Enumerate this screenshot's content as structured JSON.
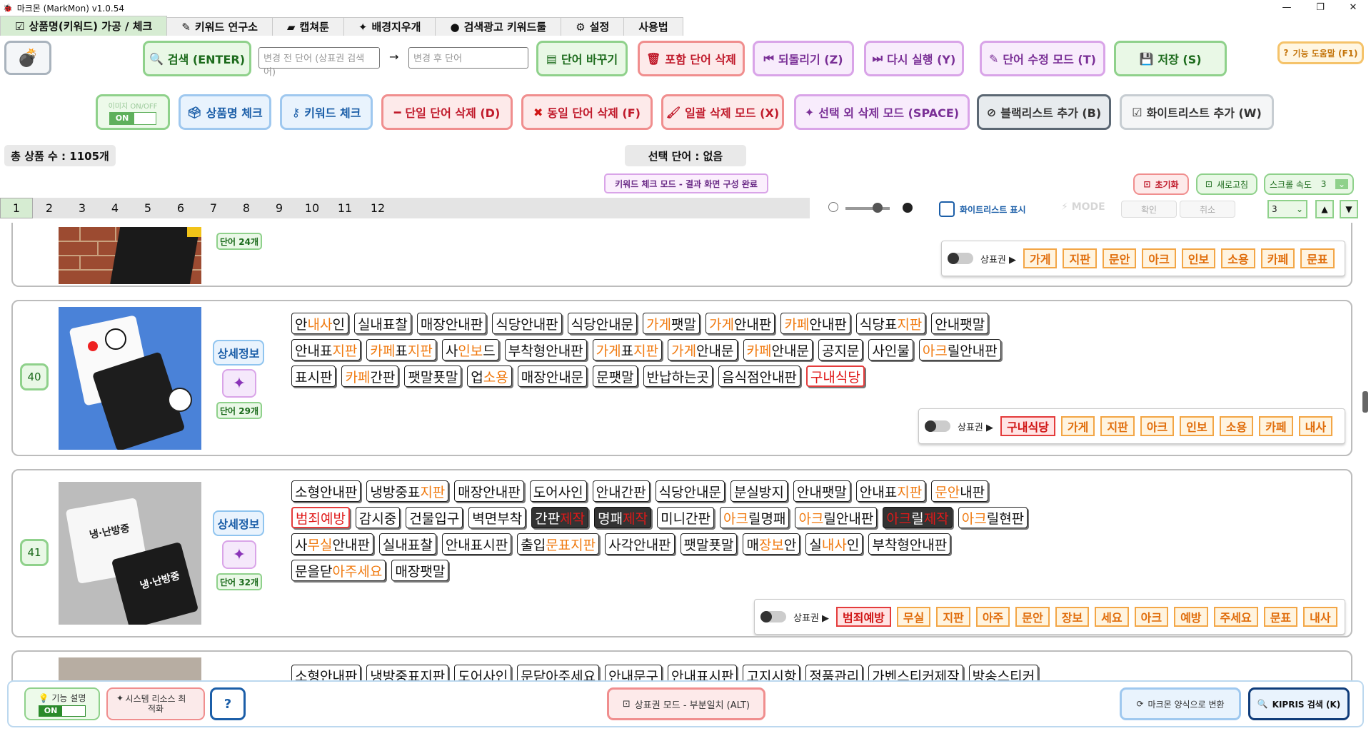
{
  "window": {
    "title": "마크몬 (MarkMon) v1.0.54"
  },
  "tabs": [
    {
      "icon": "check-box-icon",
      "label": "상품명(키워드) 가공 / 체크"
    },
    {
      "icon": "pencil-icon",
      "label": "키워드 연구소"
    },
    {
      "icon": "camera-icon",
      "label": "캡쳐툰"
    },
    {
      "icon": "sparkle-icon",
      "label": "배경지우개"
    },
    {
      "icon": "cookie-icon",
      "label": "검색광고 키워드툴"
    },
    {
      "icon": "gear-icon",
      "label": "설정"
    },
    {
      "icon": "",
      "label": "사용법"
    }
  ],
  "toolbar": {
    "search": "검색 (ENTER)",
    "before_placeholder": "변경 전 단어 (상표권 검색어)",
    "arrow": "→",
    "after_placeholder": "변경 후 단어",
    "replace": "단어 바꾸기",
    "include_delete": "포함 단어 삭제",
    "undo": "되돌리기 (Z)",
    "redo": "다시 실행 (Y)",
    "edit_mode": "단어 수정 모드 (T)",
    "save": "저장 (S)",
    "help": "기능 도움말 (F1)",
    "image_toggle_label": "이미지 ON/OFF",
    "image_toggle_state": "ON",
    "product_check": "상품명 체크",
    "keyword_check": "키워드 체크",
    "single_delete": "단일 단어 삭제 (D)",
    "same_delete": "동일 단어 삭제 (F)",
    "bulk_delete": "일괄 삭제 모드 (X)",
    "except_delete": "선택 외 삭제 모드 (SPACE)",
    "blacklist": "블랙리스트 추가 (B)",
    "whitelist": "화이트리스트 추가 (W)"
  },
  "status": {
    "total": "총 상품 수 : 1105개",
    "selected": "선택 단어 : 없음",
    "mode": "키워드 체크 모드 - 결과 화면 구성 완료"
  },
  "controls": {
    "reset": "초기화",
    "refresh": "새로고침",
    "scroll_speed_label": "스크롤 속도",
    "scroll_speed_value": "3",
    "whitelist_show": "화이트리스트 표시",
    "mode": "MODE",
    "confirm": "확인",
    "cancel": "취소",
    "page_select": "3"
  },
  "pages": [
    "1",
    "2",
    "3",
    "4",
    "5",
    "6",
    "7",
    "8",
    "9",
    "10",
    "11",
    "12"
  ],
  "cards": [
    {
      "number": "",
      "word_count": "단어 24개",
      "trademark_label": "상표권 ▶",
      "trademarks": [
        {
          "t": "가게"
        },
        {
          "t": "지판"
        },
        {
          "t": "문안"
        },
        {
          "t": "아크"
        },
        {
          "t": "인보"
        },
        {
          "t": "소용"
        },
        {
          "t": "카페"
        },
        {
          "t": "문표"
        }
      ]
    },
    {
      "number": "40",
      "detail": "상세정보",
      "word_count": "단어 29개",
      "trademark_label": "상표권 ▶",
      "trademarks": [
        {
          "t": "구내식당",
          "red": true
        },
        {
          "t": "가게"
        },
        {
          "t": "지판"
        },
        {
          "t": "아크"
        },
        {
          "t": "인보"
        },
        {
          "t": "소용"
        },
        {
          "t": "카페"
        },
        {
          "t": "내사"
        }
      ],
      "chips": [
        [
          [
            "안",
            ""
          ],
          [
            "내사",
            "o"
          ],
          [
            "인",
            ""
          ]
        ],
        [
          [
            "실내표찰",
            ""
          ]
        ],
        [
          [
            "매장안내판",
            ""
          ]
        ],
        [
          [
            "식당안내판",
            ""
          ]
        ],
        [
          [
            "식당안내문",
            ""
          ]
        ],
        [
          [
            "가게",
            "o"
          ],
          [
            "팻말",
            ""
          ]
        ],
        [
          [
            "가게",
            "o"
          ],
          [
            "안내판",
            ""
          ]
        ],
        [
          [
            "카페",
            "o"
          ],
          [
            "안내판",
            ""
          ]
        ],
        [
          [
            "식당표",
            ""
          ],
          [
            "지판",
            "o"
          ]
        ],
        [
          [
            "안내팻말",
            ""
          ]
        ],
        [
          [
            "안내표",
            ""
          ],
          [
            "지판",
            "o"
          ]
        ],
        [
          [
            "카페",
            "o"
          ],
          [
            "표",
            ""
          ],
          [
            "지판",
            "o"
          ]
        ],
        [
          [
            "사",
            ""
          ],
          [
            "인보",
            "o"
          ],
          [
            "드",
            ""
          ]
        ],
        [
          [
            "부착형안내판",
            ""
          ]
        ],
        [
          [
            "가게",
            "o"
          ],
          [
            "표",
            ""
          ],
          [
            "지판",
            "o"
          ]
        ],
        [
          [
            "가게",
            "o"
          ],
          [
            "안내문",
            ""
          ]
        ],
        [
          [
            "카페",
            "o"
          ],
          [
            "안내문",
            ""
          ]
        ],
        [
          [
            "공지문",
            ""
          ]
        ],
        [
          [
            "사인물",
            ""
          ]
        ],
        [
          [
            "아크",
            "o"
          ],
          [
            "릴안내판",
            ""
          ]
        ],
        [
          [
            "표시판",
            ""
          ]
        ],
        [
          [
            "카페",
            "o"
          ],
          [
            "간판",
            ""
          ]
        ],
        [
          [
            "팻말푯말",
            ""
          ]
        ],
        [
          [
            "업",
            ""
          ],
          [
            "소용",
            "o"
          ]
        ],
        [
          [
            "매장안내문",
            ""
          ]
        ],
        [
          [
            "문팻말",
            ""
          ]
        ],
        [
          [
            "반납하는곳",
            ""
          ]
        ],
        [
          [
            "음식점안내판",
            ""
          ]
        ],
        [
          [
            "구내식당",
            "r"
          ]
        ]
      ]
    },
    {
      "number": "41",
      "detail": "상세정보",
      "word_count": "단어 32개",
      "trademark_label": "상표권 ▶",
      "trademarks": [
        {
          "t": "범죄예방",
          "red": true
        },
        {
          "t": "무실"
        },
        {
          "t": "지판"
        },
        {
          "t": "아주"
        },
        {
          "t": "문안"
        },
        {
          "t": "장보"
        },
        {
          "t": "세요"
        },
        {
          "t": "아크"
        },
        {
          "t": "예방"
        },
        {
          "t": "주세요"
        },
        {
          "t": "문표"
        },
        {
          "t": "내사"
        }
      ],
      "chips": [
        [
          [
            "소형안내판",
            ""
          ]
        ],
        [
          [
            "냉방중표",
            ""
          ],
          [
            "지판",
            "o"
          ]
        ],
        [
          [
            "매장안내판",
            ""
          ]
        ],
        [
          [
            "도어사인",
            ""
          ]
        ],
        [
          [
            "안내간판",
            ""
          ]
        ],
        [
          [
            "식당안내문",
            ""
          ]
        ],
        [
          [
            "분실방지",
            ""
          ]
        ],
        [
          [
            "안내팻말",
            ""
          ]
        ],
        [
          [
            "안내표",
            ""
          ],
          [
            "지판",
            "o"
          ]
        ],
        [
          [
            "문안",
            "o"
          ],
          [
            "내판",
            ""
          ]
        ],
        [
          [
            "범죄예방",
            "r"
          ]
        ],
        [
          [
            "감시중",
            ""
          ]
        ],
        [
          [
            "건물입구",
            ""
          ]
        ],
        [
          [
            "벽면부착",
            ""
          ]
        ],
        [
          [
            "간판",
            "dark"
          ],
          [
            "제작",
            "dr"
          ]
        ],
        [
          [
            "명패",
            "dark"
          ],
          [
            "제작",
            "dr"
          ]
        ],
        [
          [
            "미니간판",
            ""
          ]
        ],
        [
          [
            "아크",
            "o"
          ],
          [
            "릴명패",
            ""
          ]
        ],
        [
          [
            "아크",
            "o"
          ],
          [
            "릴안내판",
            ""
          ]
        ],
        [
          [
            "아크",
            "dko"
          ],
          [
            "릴",
            "dark"
          ],
          [
            "제작",
            "dr"
          ]
        ],
        [
          [
            "아크",
            "o"
          ],
          [
            "릴현판",
            ""
          ]
        ],
        [
          [
            "사",
            ""
          ],
          [
            "무실",
            "o"
          ],
          [
            "안내판",
            ""
          ]
        ],
        [
          [
            "실내표찰",
            ""
          ]
        ],
        [
          [
            "안내표시판",
            ""
          ]
        ],
        [
          [
            "출입",
            ""
          ],
          [
            "문표",
            "o"
          ],
          [
            "지판",
            "o"
          ]
        ],
        [
          [
            "사각안내판",
            ""
          ]
        ],
        [
          [
            "팻말푯말",
            ""
          ]
        ],
        [
          [
            "매",
            ""
          ],
          [
            "장보",
            "o"
          ],
          [
            "안",
            ""
          ]
        ],
        [
          [
            "실",
            ""
          ],
          [
            "내사",
            "o"
          ],
          [
            "인",
            ""
          ]
        ],
        [
          [
            "부착형안내판",
            ""
          ]
        ],
        [
          [
            "문을닫",
            ""
          ],
          [
            "아주세요",
            "o"
          ]
        ],
        [
          [
            "매장팻말",
            ""
          ]
        ]
      ]
    }
  ],
  "partial_chips": [
    "소형안내판",
    "냉방중표지판",
    "도어사인",
    "문닫아주세요",
    "안내문구",
    "안내표시판",
    "고지시항",
    "정품관리",
    "가벤스티커제작",
    "방송스티커"
  ],
  "bottom": {
    "help_label": "기능 설명",
    "help_state": "ON",
    "optimize": "시스템 리소스 최적화",
    "question": "?",
    "trademark_mode": "상표권 모드 - 부분일치 (ALT)",
    "convert": "마크몬 양식으로 변환",
    "kipris": "KIPRIS 검색 (K)"
  }
}
